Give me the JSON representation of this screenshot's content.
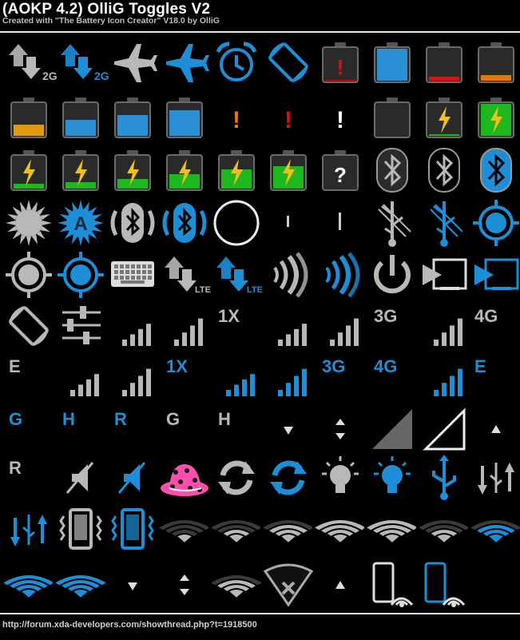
{
  "header": {
    "title": "(AOKP 4.2) OlliG Toggles V2",
    "subtitle": "Created with \"The Battery Icon Creator\" V18.0 by OlliG"
  },
  "footer": {
    "url": "http://forum.xda-developers.com/showthread.php?t=1918500"
  },
  "colors": {
    "background": "#000000",
    "white_icon": "#b8b8b8",
    "blue_icon": "#1e8fd6",
    "charge_green": "#1db81d",
    "alert_red": "#d01515",
    "alert_orange": "#e07a10",
    "bolt_yellow": "#f0c020"
  },
  "grid": {
    "rows": [
      [
        {
          "icon": "data-arrows-icon",
          "label": "2G"
        },
        {
          "icon": "data-arrows-icon",
          "label": "2G"
        },
        {
          "icon": "airplane-icon"
        },
        {
          "icon": "airplane-icon"
        },
        {
          "icon": "alarm-icon"
        },
        {
          "icon": "rotate-icon"
        },
        {
          "icon": "battery-alert-icon",
          "text": "!"
        },
        {
          "icon": "battery-full-icon",
          "level": 1.0
        },
        {
          "icon": "battery-low-icon",
          "level": 0.12
        },
        {
          "icon": "battery-low-icon",
          "level": 0.18
        }
      ],
      [
        {
          "icon": "battery-icon",
          "level": 0.35
        },
        {
          "icon": "battery-icon",
          "level": 0.5
        },
        {
          "icon": "battery-icon",
          "level": 0.65
        },
        {
          "icon": "battery-icon",
          "level": 0.8
        },
        {
          "icon": "exclamation-icon",
          "text": "!"
        },
        {
          "icon": "exclamation-icon",
          "text": "!"
        },
        {
          "icon": "exclamation-icon",
          "text": "!"
        },
        {
          "icon": "battery-empty-icon",
          "level": 0.0
        },
        {
          "icon": "battery-charging-icon",
          "level": 0.05
        },
        {
          "icon": "battery-charging-icon",
          "level": 1.0
        }
      ],
      [
        {
          "icon": "battery-charging-icon",
          "level": 0.15
        },
        {
          "icon": "battery-charging-icon",
          "level": 0.2
        },
        {
          "icon": "battery-charging-icon",
          "level": 0.3
        },
        {
          "icon": "battery-charging-icon",
          "level": 0.45
        },
        {
          "icon": "battery-charging-icon",
          "level": 0.6
        },
        {
          "icon": "battery-charging-icon",
          "level": 0.7
        },
        {
          "icon": "battery-unknown-icon",
          "text": "?"
        },
        {
          "icon": "bluetooth-icon"
        },
        {
          "icon": "bluetooth-icon"
        },
        {
          "icon": "bluetooth-icon"
        }
      ],
      [
        {
          "icon": "brightness-icon"
        },
        {
          "icon": "auto-brightness-icon",
          "text": "A"
        },
        {
          "icon": "bluetooth-discoverable-icon"
        },
        {
          "icon": "bluetooth-discoverable-icon"
        },
        {
          "icon": "circle-icon"
        },
        {
          "icon": "bar-icon"
        },
        {
          "icon": "bar-icon"
        },
        {
          "icon": "usb-tether-icon"
        },
        {
          "icon": "usb-tether-icon"
        },
        {
          "icon": "gps-icon"
        }
      ],
      [
        {
          "icon": "gps-icon"
        },
        {
          "icon": "gps-icon"
        },
        {
          "icon": "keyboard-icon"
        },
        {
          "icon": "data-arrows-icon",
          "label": "LTE"
        },
        {
          "icon": "data-arrows-icon",
          "label": "LTE"
        },
        {
          "icon": "nfc-icon"
        },
        {
          "icon": "nfc-icon"
        },
        {
          "icon": "power-icon"
        },
        {
          "icon": "screencast-icon"
        },
        {
          "icon": "screencast-icon"
        }
      ],
      [
        {
          "icon": "rotate-icon"
        },
        {
          "icon": "sliders-icon"
        },
        {
          "icon": "signal-icon",
          "level": 0.6
        },
        {
          "icon": "signal-icon",
          "level": 0.8
        },
        {
          "icon": "network-type-icon",
          "text": "1X"
        },
        {
          "icon": "signal-icon",
          "level": 0.6
        },
        {
          "icon": "signal-icon",
          "level": 0.8
        },
        {
          "icon": "network-type-icon",
          "text": "3G"
        },
        {
          "icon": "signal-icon",
          "level": 0.8
        },
        {
          "icon": "network-type-icon",
          "text": "4G"
        }
      ],
      [
        {
          "icon": "network-type-icon",
          "text": "E"
        },
        {
          "icon": "signal-icon",
          "level": 0.6
        },
        {
          "icon": "signal-icon",
          "level": 0.8
        },
        {
          "icon": "network-type-icon",
          "text": "1X"
        },
        {
          "icon": "signal-icon",
          "level": 0.6
        },
        {
          "icon": "signal-icon",
          "level": 0.8
        },
        {
          "icon": "network-type-icon",
          "text": "3G"
        },
        {
          "icon": "network-type-icon",
          "text": "4G"
        },
        {
          "icon": "signal-icon",
          "level": 0.8
        },
        {
          "icon": "network-type-icon",
          "text": "E"
        }
      ],
      [
        {
          "icon": "network-type-icon",
          "text": "G"
        },
        {
          "icon": "network-type-icon",
          "text": "H"
        },
        {
          "icon": "network-type-icon",
          "text": "R"
        },
        {
          "icon": "network-type-icon",
          "text": "G"
        },
        {
          "icon": "network-type-icon",
          "text": "H"
        },
        {
          "icon": "arrow-down-icon"
        },
        {
          "icon": "arrows-up-down-icon"
        },
        {
          "icon": "signal-solid-icon"
        },
        {
          "icon": "signal-outline-icon"
        },
        {
          "icon": "arrow-up-icon"
        }
      ],
      [
        {
          "icon": "network-type-icon",
          "text": "R"
        },
        {
          "icon": "mute-icon"
        },
        {
          "icon": "mute-icon"
        },
        {
          "icon": "hat-icon"
        },
        {
          "icon": "sync-icon"
        },
        {
          "icon": "sync-icon"
        },
        {
          "icon": "torch-icon"
        },
        {
          "icon": "torch-icon"
        },
        {
          "icon": "usb-icon"
        },
        {
          "icon": "usb-arrows-icon"
        }
      ],
      [
        {
          "icon": "usb-arrows-icon"
        },
        {
          "icon": "vibrate-icon"
        },
        {
          "icon": "vibrate-icon"
        },
        {
          "icon": "wifi-icon",
          "level": 0.0
        },
        {
          "icon": "wifi-icon",
          "level": 0.25
        },
        {
          "icon": "wifi-icon",
          "level": 0.5
        },
        {
          "icon": "wifi-icon",
          "level": 0.75
        },
        {
          "icon": "wifi-icon",
          "level": 1.0
        },
        {
          "icon": "wifi-icon",
          "level": 0.25
        },
        {
          "icon": "wifi-icon",
          "level": 0.5
        }
      ],
      [
        {
          "icon": "wifi-icon",
          "level": 0.75
        },
        {
          "icon": "wifi-icon",
          "level": 1.0
        },
        {
          "icon": "arrow-down-icon"
        },
        {
          "icon": "arrows-up-down-icon"
        },
        {
          "icon": "wifi-icon",
          "level": 0.5
        },
        {
          "icon": "wifi-off-icon"
        },
        {
          "icon": "arrow-up-icon"
        },
        {
          "icon": "wifi-display-icon"
        },
        {
          "icon": "wifi-display-icon"
        }
      ]
    ]
  }
}
